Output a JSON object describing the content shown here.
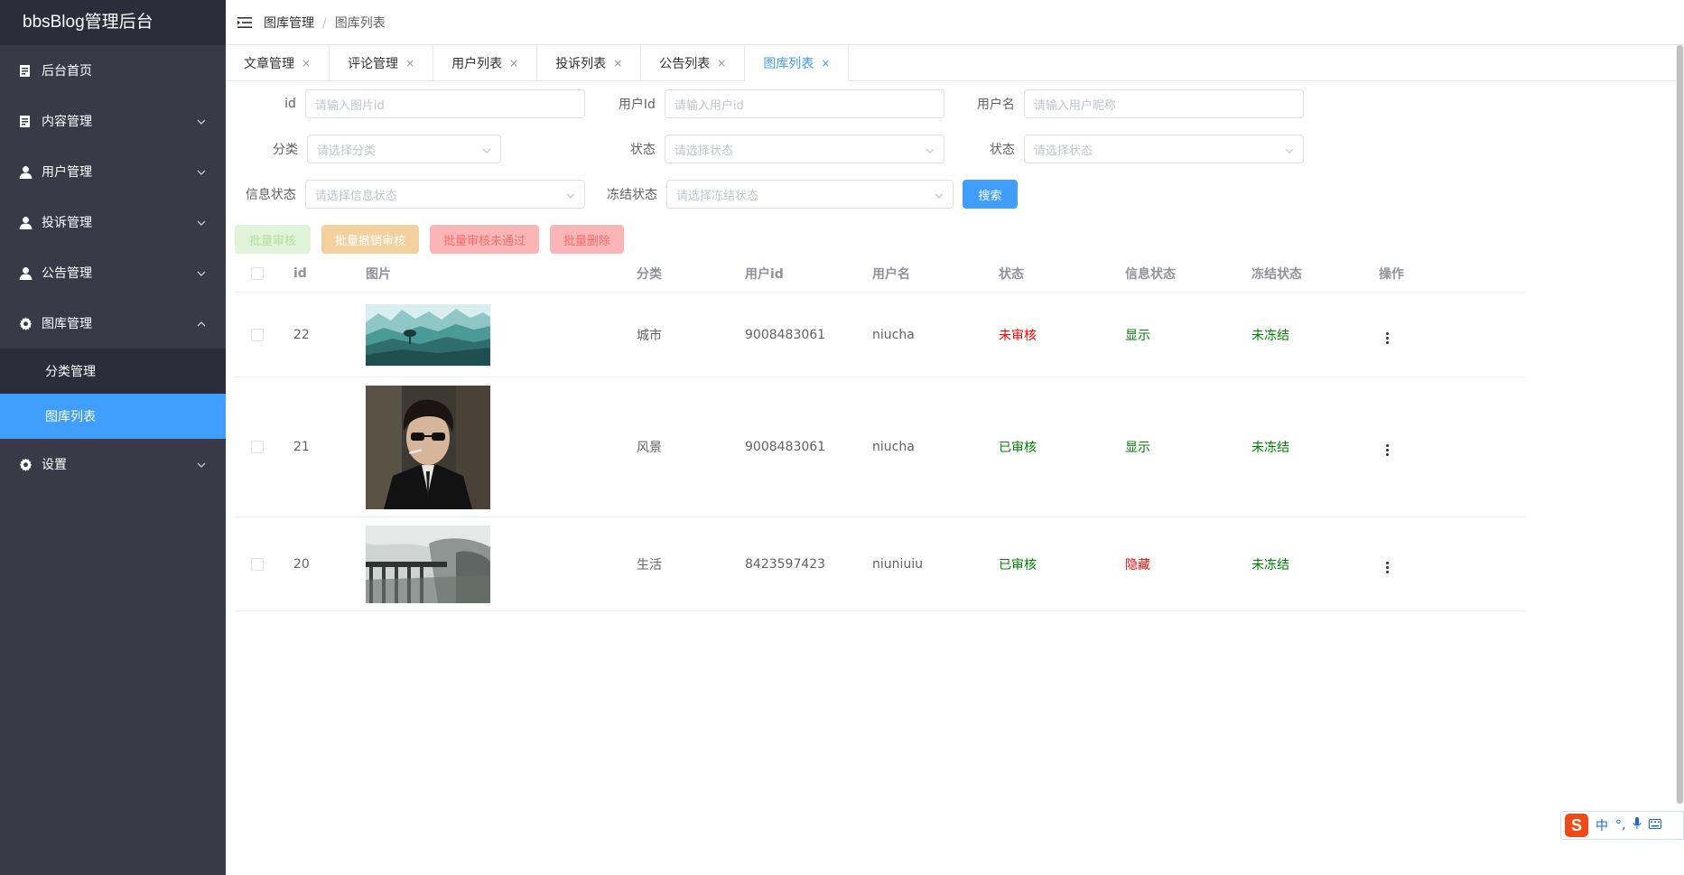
{
  "app": {
    "title": "bbsBlog管理后台"
  },
  "colors": {
    "sidebar": "#393948",
    "sidebar_dark": "#2b2d3a",
    "accent": "#409eff"
  },
  "sidebar": {
    "items": [
      {
        "label": "后台首页",
        "icon": "document-icon"
      },
      {
        "label": "内容管理",
        "icon": "document-icon",
        "expanded": false
      },
      {
        "label": "用户管理",
        "icon": "user-icon",
        "expanded": false
      },
      {
        "label": "投诉管理",
        "icon": "user-icon",
        "expanded": false
      },
      {
        "label": "公告管理",
        "icon": "user-icon",
        "expanded": false
      },
      {
        "label": "图库管理",
        "icon": "gear-icon",
        "expanded": true
      },
      {
        "label": "设置",
        "icon": "gear-icon",
        "expanded": false
      }
    ],
    "submenu": [
      {
        "label": "分类管理",
        "active": false
      },
      {
        "label": "图库列表",
        "active": true
      }
    ]
  },
  "breadcrumb": {
    "parent": "图库管理",
    "sep": "/",
    "current": "图库列表"
  },
  "tabs": [
    {
      "label": "文章管理",
      "active": false
    },
    {
      "label": "评论管理",
      "active": false
    },
    {
      "label": "用户列表",
      "active": false
    },
    {
      "label": "投诉列表",
      "active": false
    },
    {
      "label": "公告列表",
      "active": false
    },
    {
      "label": "图库列表",
      "active": true
    }
  ],
  "tab_close": "×",
  "filters": {
    "id": {
      "label": "id",
      "placeholder": "请输入图片id"
    },
    "userId": {
      "label": "用户Id",
      "placeholder": "请输入用户id"
    },
    "userName": {
      "label": "用户名",
      "placeholder": "请输入用户昵称"
    },
    "category": {
      "label": "分类",
      "placeholder": "请选择分类"
    },
    "status1": {
      "label": "状态",
      "placeholder": "请选择状态"
    },
    "status2": {
      "label": "状态",
      "placeholder": "请选择状态"
    },
    "infoStatus": {
      "label": "信息状态",
      "placeholder": "请选择信息状态"
    },
    "freezeStatus": {
      "label": "冻结状态",
      "placeholder": "请选择冻结状态"
    },
    "search_label": "搜索"
  },
  "batch": {
    "approve": "批量审核",
    "revoke": "批量撤销审核",
    "reject": "批量审核未通过",
    "delete": "批量删除"
  },
  "table": {
    "headers": {
      "id": "id",
      "image": "图片",
      "category": "分类",
      "userId": "用户id",
      "userName": "用户名",
      "status": "状态",
      "info": "信息状态",
      "freeze": "冻结状态",
      "op": "操作"
    },
    "rows": [
      {
        "id": "22",
        "image": "landscape",
        "category": "城市",
        "userId": "9008483061",
        "userName": "niucha",
        "status": "未审核",
        "status_color": "red",
        "info": "显示",
        "info_color": "green",
        "freeze": "未冻结",
        "freeze_color": "green"
      },
      {
        "id": "21",
        "image": "portrait",
        "category": "风景",
        "userId": "9008483061",
        "userName": "niucha",
        "status": "已审核",
        "status_color": "green",
        "info": "显示",
        "info_color": "green",
        "freeze": "未冻结",
        "freeze_color": "green"
      },
      {
        "id": "20",
        "image": "bridge",
        "category": "生活",
        "userId": "8423597423",
        "userName": "niuniuiu",
        "status": "已审核",
        "status_color": "green",
        "info": "隐藏",
        "info_color": "red",
        "freeze": "未冻结",
        "freeze_color": "green"
      }
    ]
  },
  "ime": {
    "logo": "S",
    "label": "中"
  }
}
